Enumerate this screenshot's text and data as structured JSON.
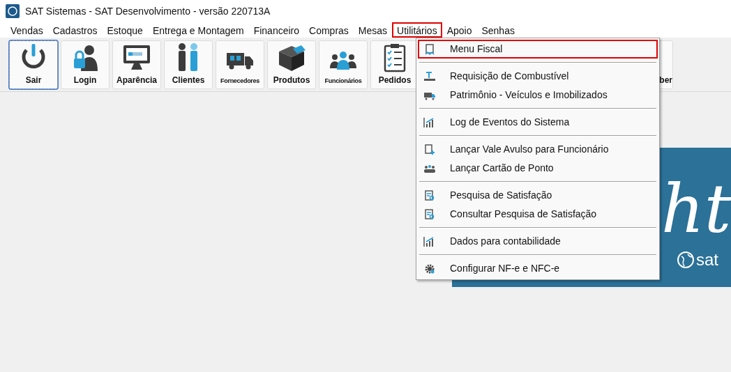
{
  "window": {
    "title": "SAT Sistemas - SAT Desenvolvimento - versão 220713A"
  },
  "menubar": [
    {
      "label": "Vendas",
      "highlighted": false
    },
    {
      "label": "Cadastros",
      "highlighted": false
    },
    {
      "label": "Estoque",
      "highlighted": false
    },
    {
      "label": "Entrega e Montagem",
      "highlighted": false
    },
    {
      "label": "Financeiro",
      "highlighted": false
    },
    {
      "label": "Compras",
      "highlighted": false
    },
    {
      "label": "Mesas",
      "highlighted": false
    },
    {
      "label": "Utilitários",
      "highlighted": true
    },
    {
      "label": "Apoio",
      "highlighted": false
    },
    {
      "label": "Senhas",
      "highlighted": false
    }
  ],
  "toolbar": [
    {
      "label": "Sair",
      "focused": true,
      "compact": false
    },
    {
      "label": "Login",
      "focused": false,
      "compact": false
    },
    {
      "label": "Aparência",
      "focused": false,
      "compact": false
    },
    {
      "label": "Clientes",
      "focused": false,
      "compact": false
    },
    {
      "label": "Fornecedores",
      "focused": false,
      "compact": true
    },
    {
      "label": "Produtos",
      "focused": false,
      "compact": false
    },
    {
      "label": "Funcionários",
      "focused": false,
      "compact": true
    },
    {
      "label": "Pedidos",
      "focused": false,
      "compact": false
    }
  ],
  "toolbar_partial": {
    "label": "ber"
  },
  "dropdown": [
    {
      "kind": "item",
      "label": "Menu Fiscal",
      "highlighted": true
    },
    {
      "kind": "separator"
    },
    {
      "kind": "item",
      "label": "Requisição de Combustível",
      "highlighted": false
    },
    {
      "kind": "item",
      "label": "Patrimônio - Veículos e Imobilizados",
      "highlighted": false
    },
    {
      "kind": "separator"
    },
    {
      "kind": "item",
      "label": "Log de Eventos do Sistema",
      "highlighted": false
    },
    {
      "kind": "separator"
    },
    {
      "kind": "item",
      "label": "Lançar Vale Avulso para Funcionário",
      "highlighted": false
    },
    {
      "kind": "item",
      "label": "Lançar Cartão de Ponto",
      "highlighted": false
    },
    {
      "kind": "separator"
    },
    {
      "kind": "item",
      "label": "Pesquisa de Satisfação",
      "highlighted": false
    },
    {
      "kind": "item",
      "label": "Consultar Pesquisa de Satisfação",
      "highlighted": false
    },
    {
      "kind": "separator"
    },
    {
      "kind": "item",
      "label": "Dados para contabilidade",
      "highlighted": false
    },
    {
      "kind": "separator"
    },
    {
      "kind": "item",
      "label": "Configurar NF-e e NFC-e",
      "highlighted": false
    }
  ],
  "banner": {
    "script_text": "ht",
    "logo_text": "sat"
  }
}
